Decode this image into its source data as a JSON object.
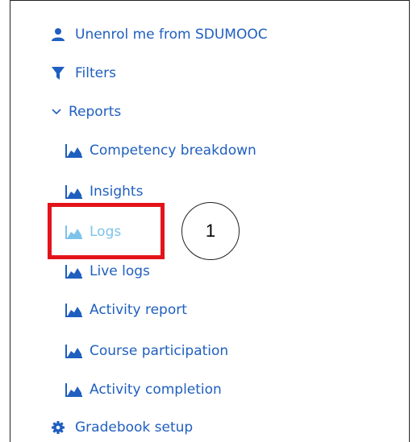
{
  "menu": {
    "unenrol_label": "Unenrol me from SDUMOOC",
    "filters_label": "Filters",
    "reports_label": "Reports",
    "report_items": [
      {
        "label": "Competency breakdown"
      },
      {
        "label": "Insights"
      },
      {
        "label": "Logs"
      },
      {
        "label": "Live logs"
      },
      {
        "label": "Activity report"
      },
      {
        "label": "Course participation"
      },
      {
        "label": "Activity completion"
      }
    ],
    "gradebook_label": "Gradebook setup"
  },
  "annotation": {
    "callout_number": "1"
  },
  "colors": {
    "link": "#1f5fbf",
    "active": "#7cc3ec",
    "highlight": "#e3131b"
  }
}
